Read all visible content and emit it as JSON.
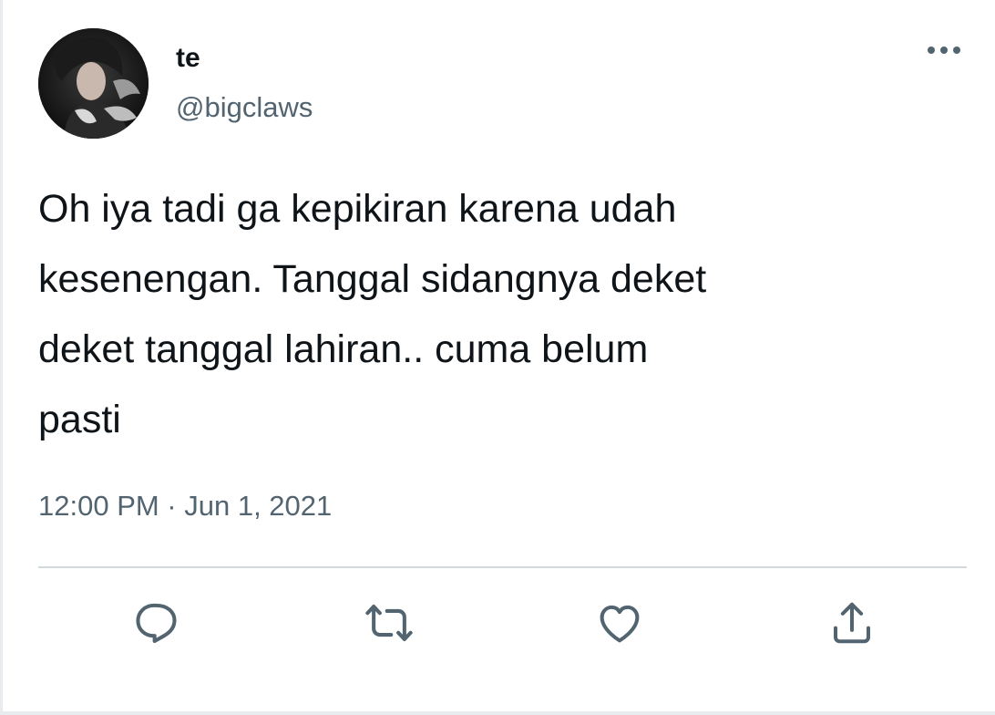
{
  "tweet": {
    "author": {
      "display_name": "te",
      "handle": "@bigclaws"
    },
    "text": "Oh iya tadi ga kepikiran karena udah\nkesenengan. Tanggal sidangnya deket\ndeket tanggal lahiran.. cuma belum\npasti",
    "timestamp": "12:00 PM · Jun 1, 2021"
  },
  "icons": {
    "more": "more-horizontal-icon",
    "reply": "reply-icon",
    "retweet": "retweet-icon",
    "like": "heart-icon",
    "share": "share-icon"
  },
  "colors": {
    "text_primary": "#0f1419",
    "text_secondary": "#536471",
    "divider": "#cfd9de"
  }
}
